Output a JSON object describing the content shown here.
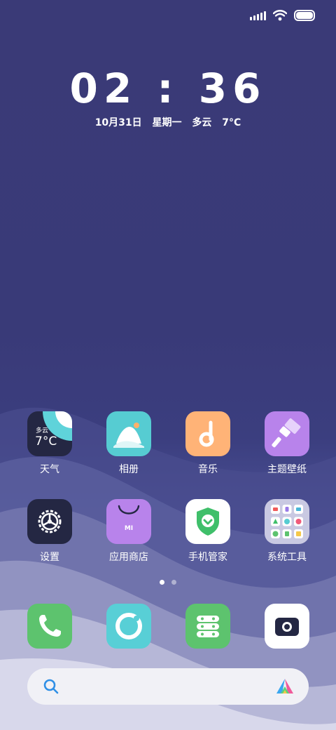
{
  "status": {
    "battery_level": 1.0,
    "signal_bars": 5
  },
  "lockscreen": {
    "time": "02 : 36",
    "date": "10月31日",
    "weekday": "星期一",
    "weather": "多云",
    "temperature": "7°C"
  },
  "home": {
    "row1": [
      {
        "label": "天气",
        "icon": "weather-icon",
        "mini_weather": "多云",
        "mini_temp": "7°C"
      },
      {
        "label": "相册",
        "icon": "gallery-icon"
      },
      {
        "label": "音乐",
        "icon": "music-icon"
      },
      {
        "label": "主题壁纸",
        "icon": "theme-icon"
      }
    ],
    "row2": [
      {
        "label": "设置",
        "icon": "settings-icon"
      },
      {
        "label": "应用商店",
        "icon": "app-store-icon",
        "mi": "MI"
      },
      {
        "label": "手机管家",
        "icon": "security-icon"
      },
      {
        "label": "系统工具",
        "icon": "folder-icon"
      }
    ],
    "page_count": 2,
    "active_page": 1
  },
  "dock": [
    {
      "icon": "phone-icon"
    },
    {
      "icon": "browser-icon"
    },
    {
      "icon": "messages-icon"
    },
    {
      "icon": "camera-icon"
    }
  ],
  "search": {
    "icon": "search-icon",
    "assistant_icon": "assistant-icon"
  },
  "colors": {
    "weather_bg": "#242743",
    "weather_accent": "#5fd3da",
    "gallery_bg": "#56ccd2",
    "music_bg": "#ffb377",
    "theme_bg": "#b883eb",
    "settings_bg": "#242743",
    "store_bg": "#b883eb",
    "security_bg": "#ffffff",
    "folder_bg": "#c9c9e2",
    "phone_bg": "#5dc36e",
    "browser_bg": "#58cfd6",
    "messages_bg": "#5dc36e",
    "camera_bg": "#ffffff",
    "search_bg": "#f1f1f6"
  }
}
